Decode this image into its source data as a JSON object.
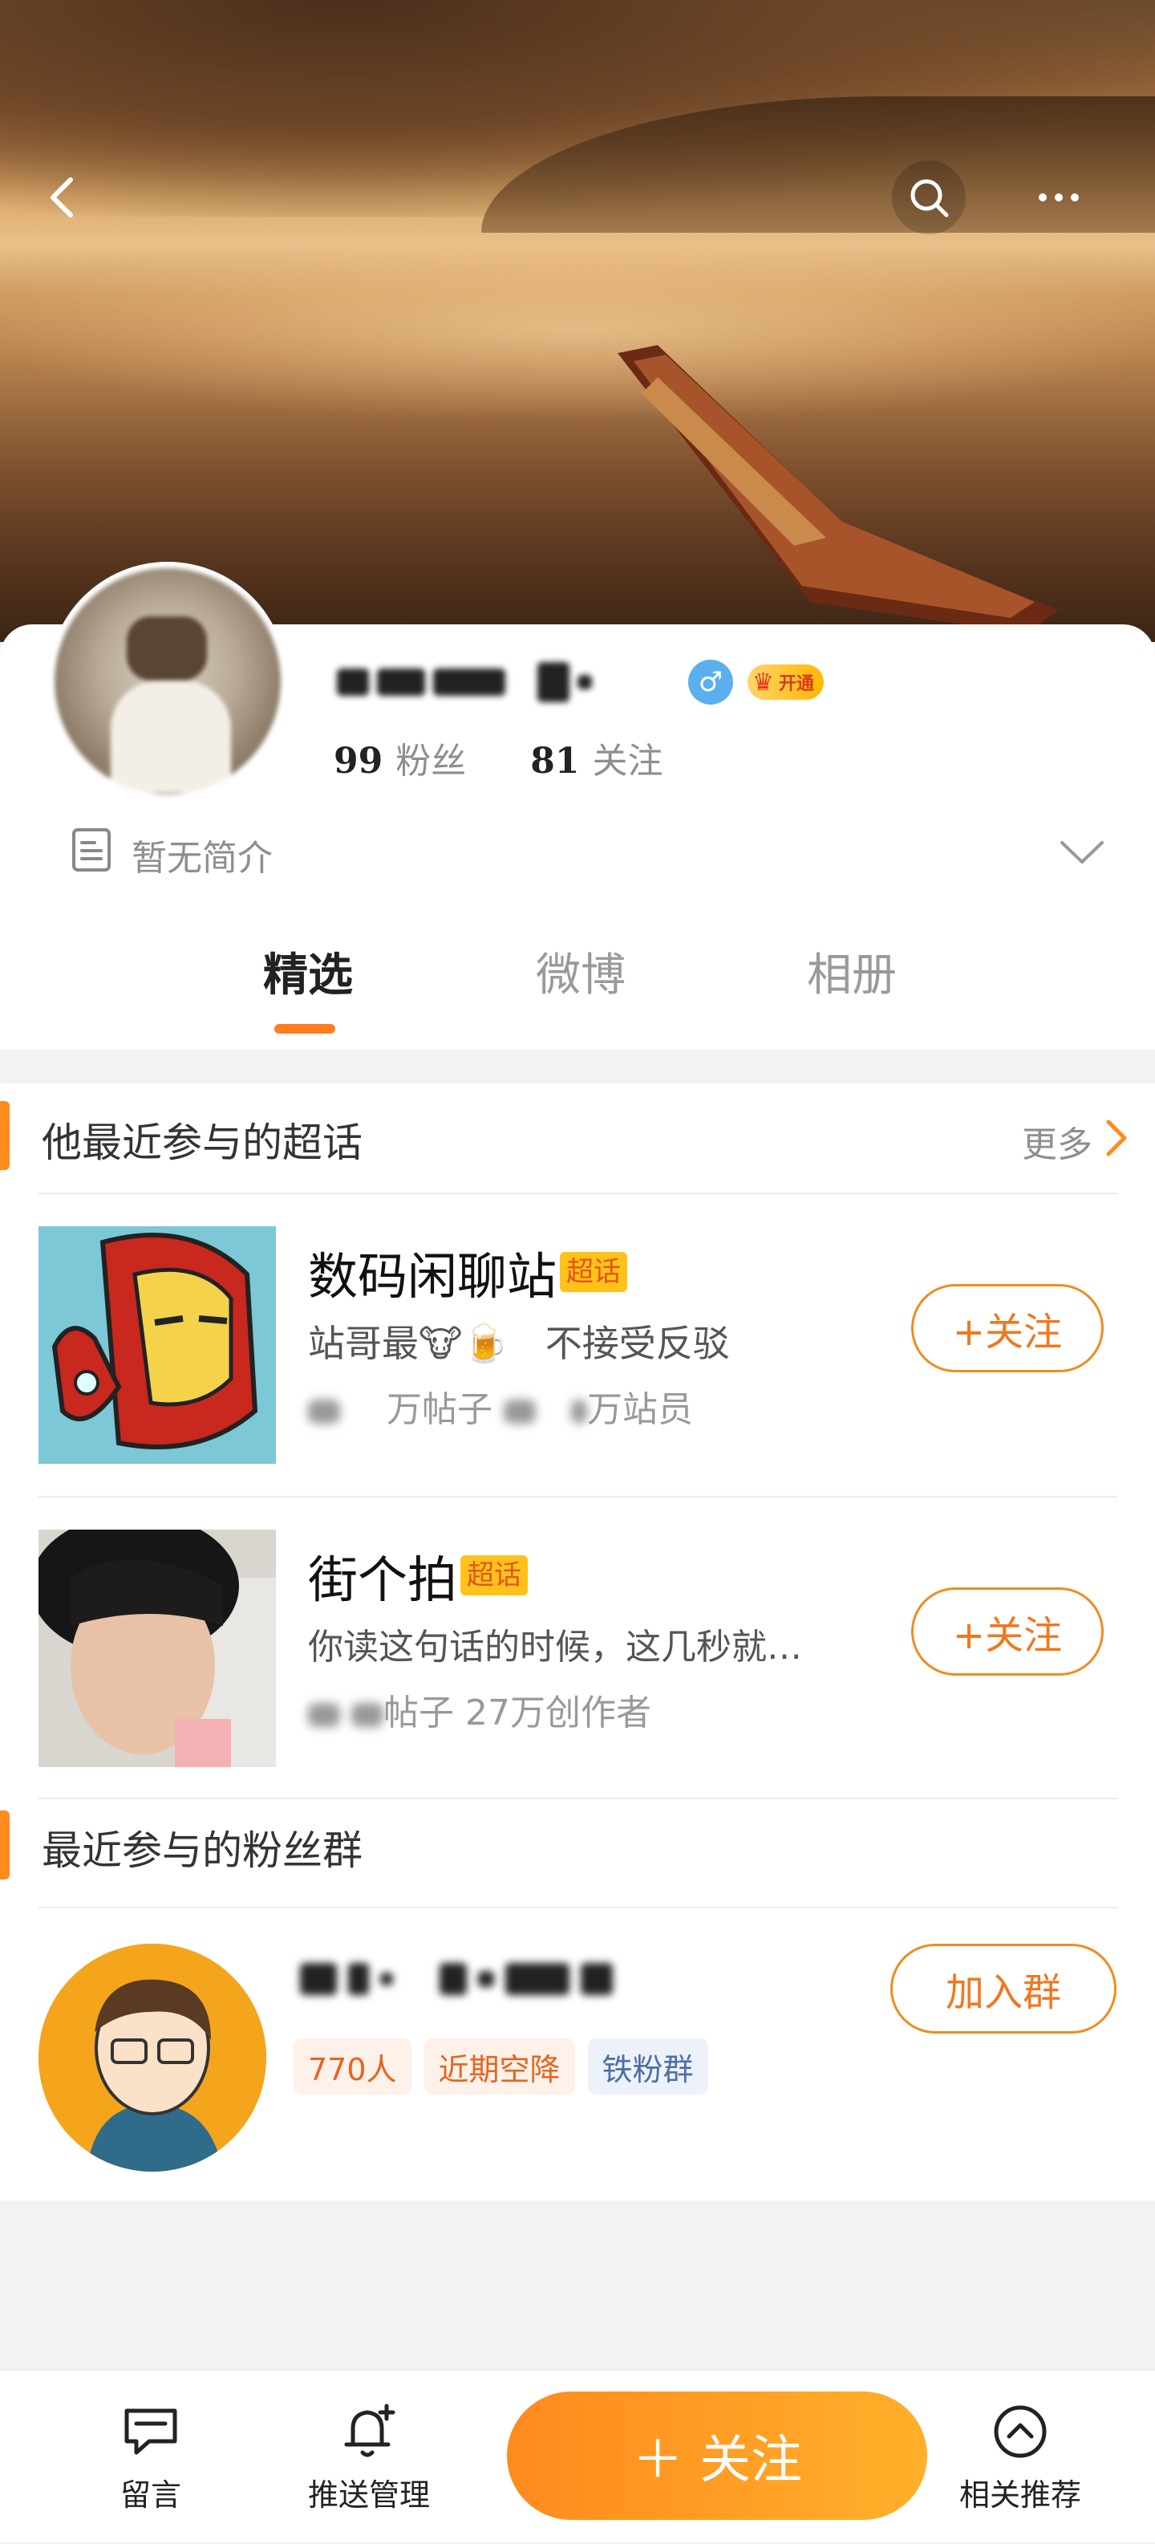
{
  "header": {
    "back_icon": "chevron-left-icon",
    "search_icon": "search-icon",
    "more_icon": "more-horizontal-icon"
  },
  "profile": {
    "vip_label": "开通",
    "gender": "male",
    "gender_symbol": "♂",
    "fans_count": "99",
    "fans_label": "粉丝",
    "following_count": "81",
    "following_label": "关注",
    "bio": "暂无简介"
  },
  "tabs": [
    {
      "label": "精选",
      "active": true
    },
    {
      "label": "微博",
      "active": false
    },
    {
      "label": "相册",
      "active": false
    }
  ],
  "super_topics": {
    "title": "他最近参与的超话",
    "more_label": "更多",
    "items": [
      {
        "name": "数码闲聊站",
        "tag": "超话",
        "desc": "站哥最",
        "desc_emoji": "🐮🍺",
        "desc_tail": "不接受反驳",
        "meta_posts_suffix": "万帖子",
        "meta_members_suffix": "万站员",
        "follow_label": "+关注"
      },
      {
        "name": "街个拍",
        "tag": "超话",
        "desc": "你读这句话的时候，这几秒就…",
        "meta_posts_suffix": "帖子",
        "meta_creators": "27万创作者",
        "follow_label": "+关注"
      }
    ]
  },
  "fan_groups": {
    "title": "最近参与的粉丝群",
    "item": {
      "members": "770人",
      "tag1": "近期空降",
      "tag2": "铁粉群",
      "join_label": "加入群"
    }
  },
  "bottom_bar": {
    "message": "留言",
    "push": "推送管理",
    "follow": "关注",
    "recommend": "相关推荐"
  },
  "colors": {
    "accent": "#ff8a1e",
    "accent_text": "#f0781e",
    "super_tag_bg": "#ffc21a",
    "chip_blue_text": "#4d6fa3"
  }
}
